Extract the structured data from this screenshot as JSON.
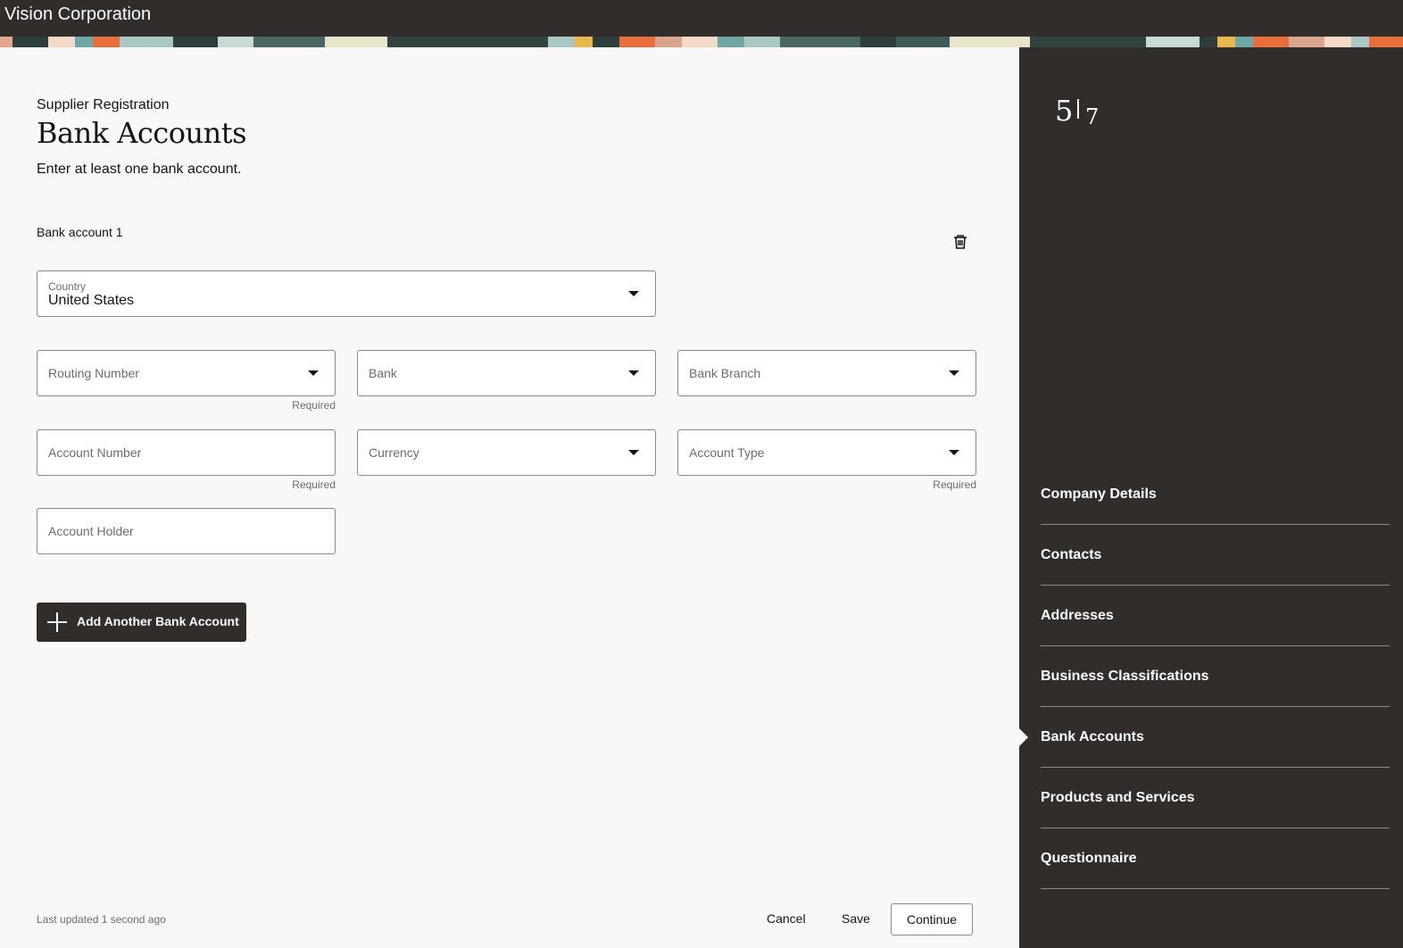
{
  "header": {
    "brand": "Vision Corporation"
  },
  "page": {
    "eyebrow": "Supplier Registration",
    "title": "Bank Accounts",
    "instructions": "Enter at least one bank account."
  },
  "bank_account": {
    "section_label": "Bank account 1",
    "country": {
      "label": "Country",
      "value": "United States"
    },
    "routing_number": {
      "placeholder": "Routing Number",
      "hint": "Required"
    },
    "bank": {
      "placeholder": "Bank"
    },
    "bank_branch": {
      "placeholder": "Bank Branch"
    },
    "account_number": {
      "placeholder": "Account Number",
      "hint": "Required"
    },
    "currency": {
      "placeholder": "Currency"
    },
    "account_type": {
      "placeholder": "Account Type",
      "hint": "Required"
    },
    "account_holder": {
      "placeholder": "Account Holder"
    }
  },
  "actions": {
    "add_label": "Add Another Bank Account",
    "cancel_label": "Cancel",
    "save_label": "Save",
    "continue_label": "Continue"
  },
  "footer": {
    "last_updated": "Last updated 1 second ago"
  },
  "progress": {
    "current": "5",
    "total": "7"
  },
  "steps": [
    {
      "label": "Company Details"
    },
    {
      "label": "Contacts"
    },
    {
      "label": "Addresses"
    },
    {
      "label": "Business Classifications"
    },
    {
      "label": "Bank Accounts",
      "active": true
    },
    {
      "label": "Products and Services"
    },
    {
      "label": "Questionnaire"
    }
  ],
  "colors": {
    "header_bg": "#312d2a",
    "sidebar_bg": "#312d2a",
    "page_bg": "#f9f8f6",
    "accent_orange": "#f0803c"
  },
  "icons": {
    "delete": "trash-icon",
    "add": "plus-icon",
    "dropdown": "caret-down-icon"
  }
}
